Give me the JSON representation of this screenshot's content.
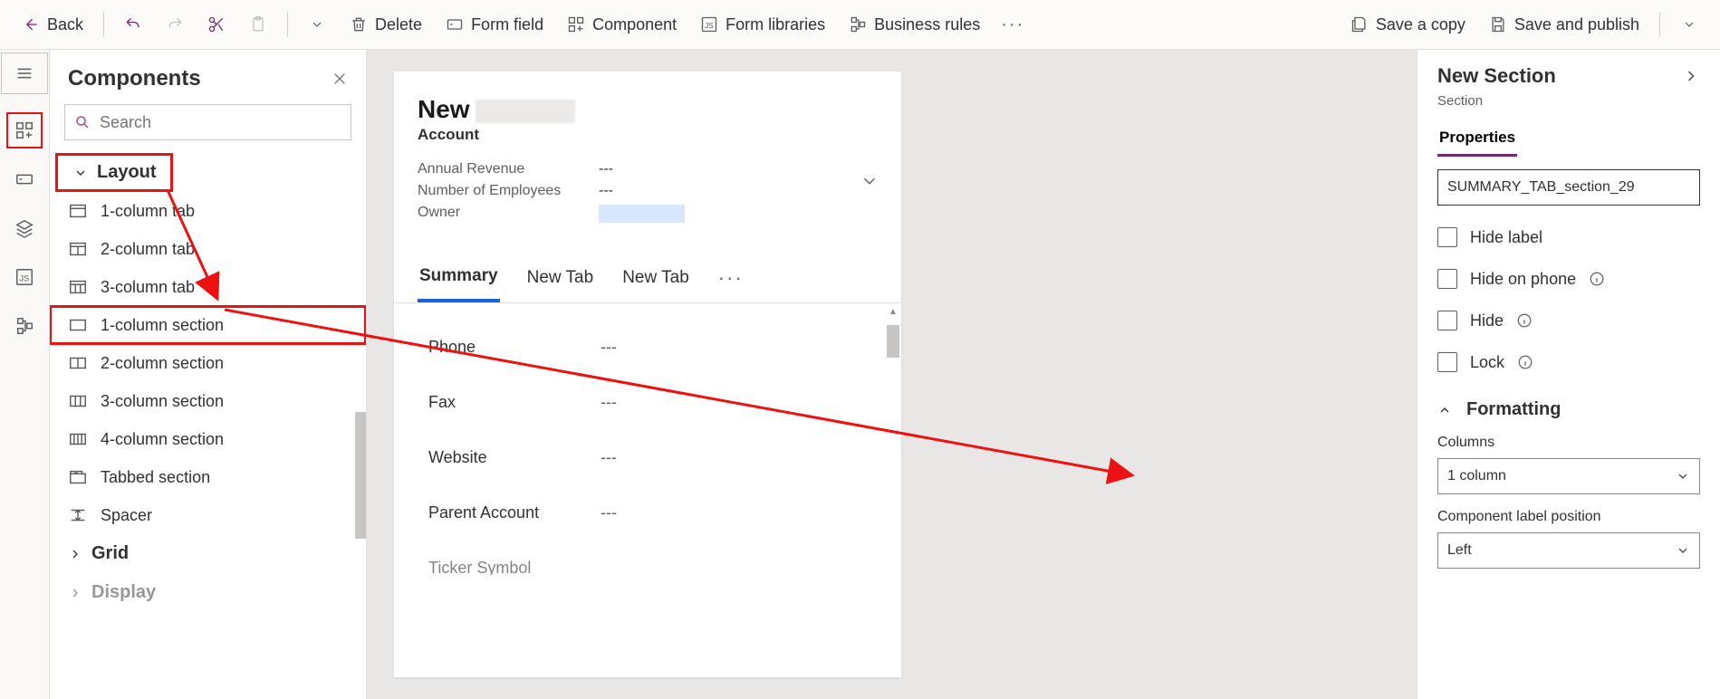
{
  "toolbar": {
    "back": "Back",
    "delete": "Delete",
    "form_field": "Form field",
    "component": "Component",
    "form_libraries": "Form libraries",
    "business_rules": "Business rules",
    "save_copy": "Save a copy",
    "save_publish": "Save and publish"
  },
  "panel": {
    "title": "Components",
    "search_placeholder": "Search",
    "groups": {
      "layout": "Layout",
      "grid": "Grid",
      "display": "Display"
    },
    "items": {
      "tab1": "1-column tab",
      "tab2": "2-column tab",
      "tab3": "3-column tab",
      "sec1": "1-column section",
      "sec2": "2-column section",
      "sec3": "3-column section",
      "sec4": "4-column section",
      "tabsec": "Tabbed section",
      "spacer": "Spacer"
    }
  },
  "form": {
    "title_prefix": "New",
    "entity": "Account",
    "meta": {
      "revenue_k": "Annual Revenue",
      "revenue_v": "---",
      "emp_k": "Number of Employees",
      "emp_v": "---",
      "owner_k": "Owner"
    },
    "tabs": {
      "summary": "Summary",
      "new1": "New Tab",
      "new2": "New Tab"
    },
    "fields": {
      "phone_k": "Phone",
      "phone_v": "---",
      "fax_k": "Fax",
      "fax_v": "---",
      "web_k": "Website",
      "web_v": "---",
      "parent_k": "Parent Account",
      "parent_v": "---",
      "ticker_k": "Ticker Symbol"
    }
  },
  "props": {
    "title": "New Section",
    "sub": "Section",
    "tab": "Properties",
    "name_value": "SUMMARY_TAB_section_29",
    "hide_label": "Hide label",
    "hide_phone": "Hide on phone",
    "hide": "Hide",
    "lock": "Lock",
    "formatting": "Formatting",
    "columns_label": "Columns",
    "columns_value": "1 column",
    "clp_label": "Component label position",
    "clp_value": "Left"
  }
}
